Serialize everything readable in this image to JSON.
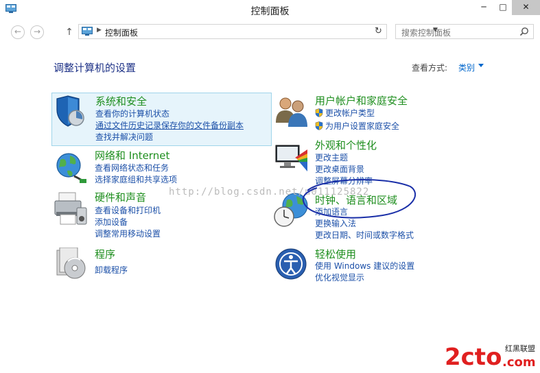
{
  "window": {
    "title": "控制面板",
    "minimize_label": "─",
    "maximize_label": "□",
    "close_label": "✕"
  },
  "nav": {
    "back_icon": "arrow-left-icon",
    "forward_icon": "arrow-right-icon",
    "up_icon": "arrow-up-icon",
    "breadcrumb": "控制面板",
    "search_placeholder": "搜索控制面板"
  },
  "header": {
    "title": "调整计算机的设置",
    "view_by_label": "查看方式:",
    "view_by_value": "类别"
  },
  "categories": [
    {
      "title": "系统和安全",
      "icon": "shield-icon",
      "links": [
        "查看你的计算机状态",
        "通过文件历史记录保存你的文件备份副本",
        "查找并解决问题"
      ]
    },
    {
      "title": "网络和 Internet",
      "icon": "network-globe-icon",
      "links": [
        "查看网络状态和任务",
        "选择家庭组和共享选项"
      ]
    },
    {
      "title": "硬件和声音",
      "icon": "printer-icon",
      "links": [
        "查看设备和打印机",
        "添加设备",
        "调整常用移动设置"
      ]
    },
    {
      "title": "程序",
      "icon": "programs-disc-icon",
      "links": [
        "卸载程序"
      ]
    },
    {
      "title": "用户帐户和家庭安全",
      "icon": "users-icon",
      "links": [
        "更改帐户类型",
        "为用户设置家庭安全"
      ]
    },
    {
      "title": "外观和个性化",
      "icon": "monitor-palette-icon",
      "links": [
        "更改主题",
        "更改桌面背景",
        "调整屏幕分辨率"
      ]
    },
    {
      "title": "时钟、语言和区域",
      "icon": "clock-globe-icon",
      "links": [
        "添加语言",
        "更换输入法",
        "更改日期、时间或数字格式"
      ]
    },
    {
      "title": "轻松使用",
      "icon": "ease-of-access-icon",
      "links": [
        "使用 Windows 建议的设置",
        "优化视觉显示"
      ]
    }
  ],
  "watermark": "http://blog.csdn.net/u011125822",
  "logo": {
    "main": "2cto",
    ".com": ".com",
    "tag": "红黑联盟"
  },
  "colors": {
    "title_green": "#1e8e1e",
    "link_blue": "#1c50a8",
    "heading_blue": "#1e3287",
    "selection_bg": "#e6f4fb",
    "annotation_ellipse": "#1a2fa8",
    "logo_red": "#e02020"
  }
}
